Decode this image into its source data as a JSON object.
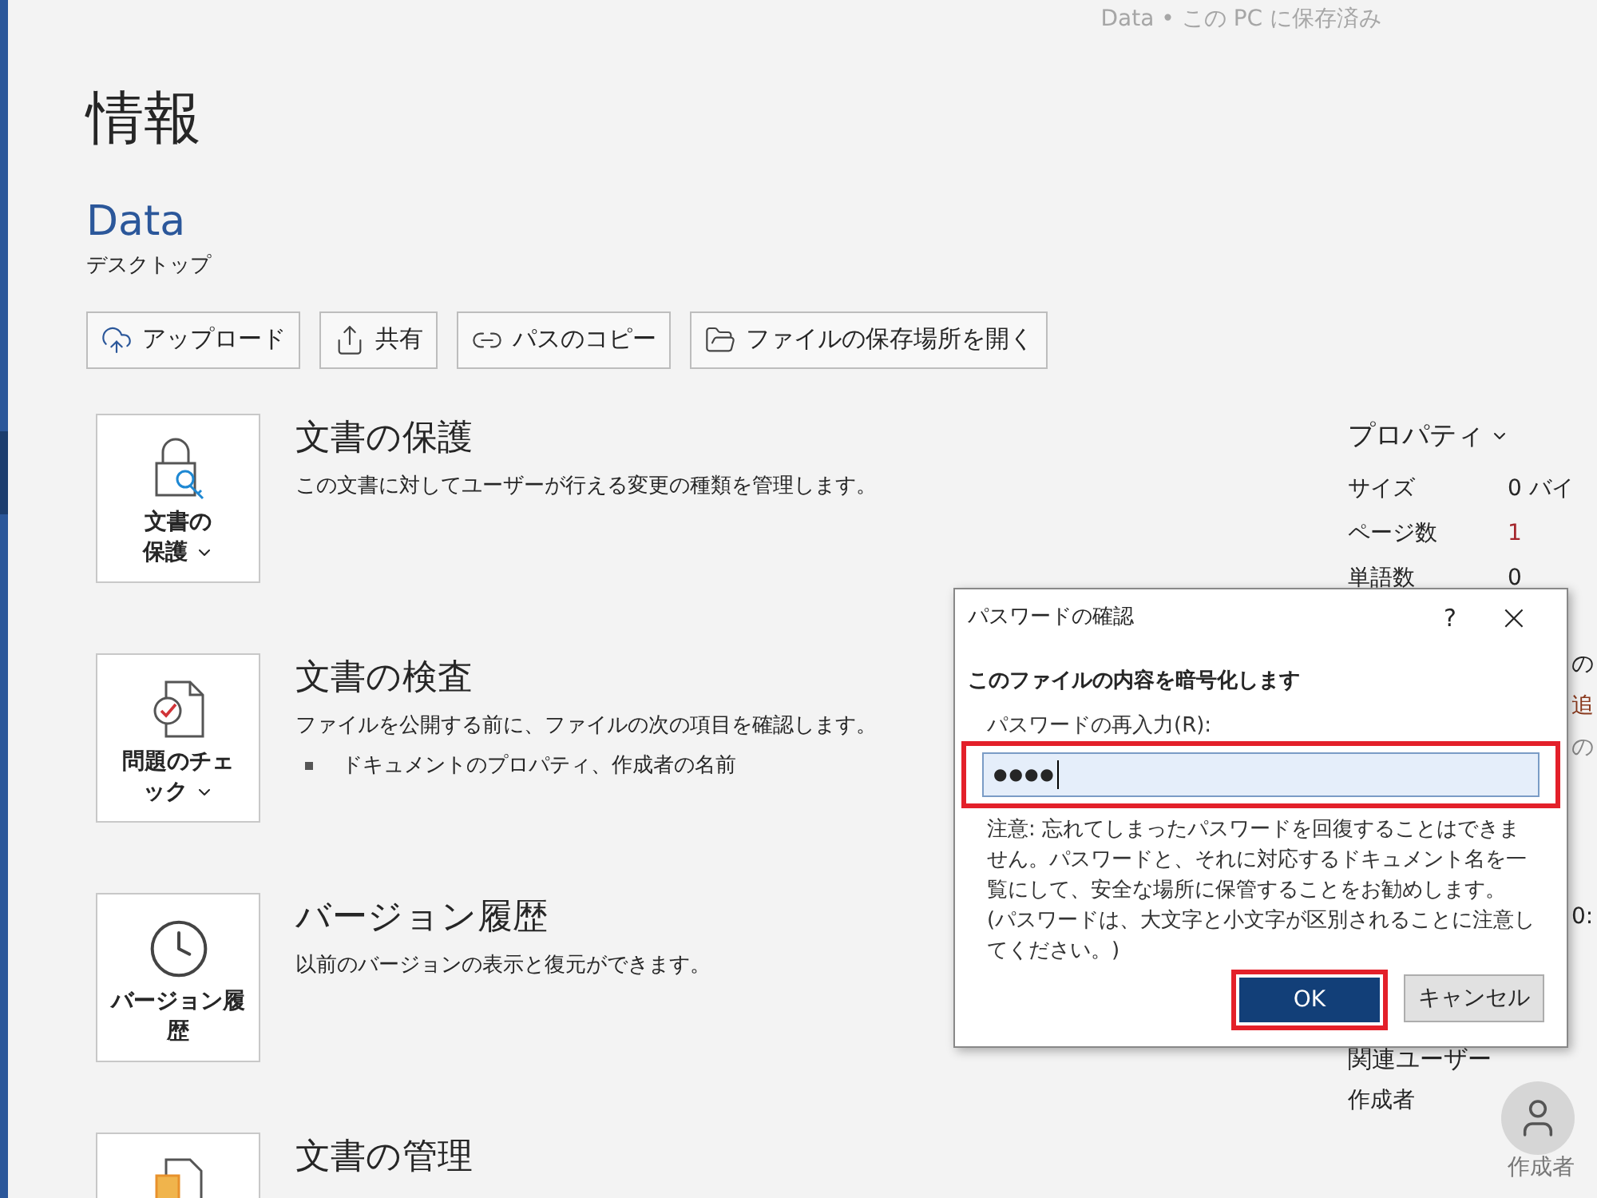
{
  "save_status": "Data • この PC に保存済み",
  "page_title": "情報",
  "document": {
    "name": "Data",
    "location": "デスクトップ"
  },
  "actions": [
    {
      "label": "アップロード"
    },
    {
      "label": "共有"
    },
    {
      "label": "パスのコピー"
    },
    {
      "label": "ファイルの保存場所を開く"
    }
  ],
  "sections": [
    {
      "button": "文書の保護",
      "dropdown": true,
      "title": "文書の保護",
      "description": "この文書に対してユーザーが行える変更の種類を管理します。"
    },
    {
      "button": "問題のチェック",
      "dropdown": true,
      "title": "文書の検査",
      "description": "ファイルを公開する前に、ファイルの次の項目を確認します。",
      "bullets": [
        "ドキュメントのプロパティ、作成者の名前"
      ]
    },
    {
      "button": "バージョン履歴",
      "dropdown": false,
      "title": "バージョン履歴",
      "description": "以前のバージョンの表示と復元ができます。"
    },
    {
      "title": "文書の管理"
    }
  ],
  "properties": {
    "heading": "プロパティ",
    "rows": [
      {
        "label": "サイズ",
        "value": "0 バイ"
      },
      {
        "label": "ページ数",
        "value": "1"
      },
      {
        "label": "単語数",
        "value": "0"
      }
    ],
    "fragments": [
      "の",
      "追",
      "の",
      "0:"
    ],
    "related_users": "関連ユーザー",
    "author_label": "作成者",
    "author_caption": "作成者"
  },
  "dialog": {
    "title": "パスワードの確認",
    "help": "?",
    "close": "×",
    "heading": "このファイルの内容を暗号化します",
    "field_label": "パスワードの再入力(R):",
    "value": "●●●●",
    "note": "注意: 忘れてしまったパスワードを回復することはできません。パスワードと、それに対応するドキュメント名を一覧にして、安全な場所に保管することをお勧めします。\n(パスワードは、大文字と小文字が区別されることに注意してください。)",
    "ok": "OK",
    "cancel": "キャンセル"
  }
}
